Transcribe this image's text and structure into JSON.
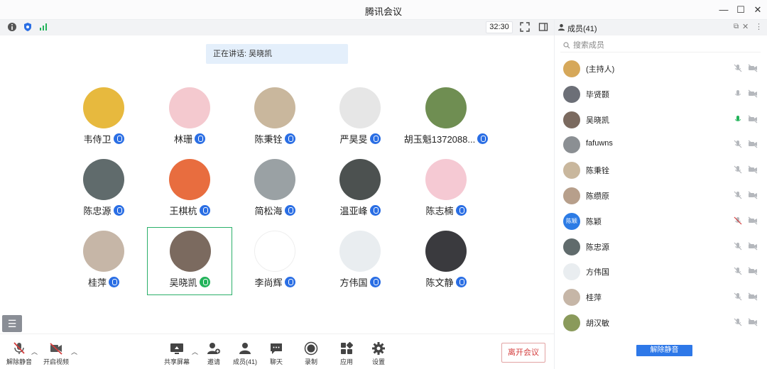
{
  "window": {
    "title": "腾讯会议"
  },
  "toolbar": {
    "timer": "32:30"
  },
  "speaking": {
    "label": "正在讲话: 吴晓凯"
  },
  "grid": [
    {
      "name": "韦侍卫",
      "mic": "on",
      "avatar": "#e7b93e"
    },
    {
      "name": "林珊",
      "mic": "on",
      "avatar": "#f4c9cf"
    },
    {
      "name": "陈秉铨",
      "mic": "on",
      "avatar": "#c9b79d"
    },
    {
      "name": "严昊旻",
      "mic": "on",
      "avatar": "#e6e6e6"
    },
    {
      "name": "胡玉魁1372088...",
      "mic": "on",
      "avatar": "#6f8e52"
    },
    {
      "name": "陈忠源",
      "mic": "on",
      "avatar": "#606b6c"
    },
    {
      "name": "王棋杭",
      "mic": "on",
      "avatar": "#e86d3f"
    },
    {
      "name": "简松海",
      "mic": "on",
      "avatar": "#9aa1a4"
    },
    {
      "name": "温亚峰",
      "mic": "on",
      "avatar": "#4c5150"
    },
    {
      "name": "陈志楠",
      "mic": "on",
      "avatar": "#f5c9d3"
    },
    {
      "name": "桂萍",
      "mic": "on",
      "avatar": "#c6b6a7"
    },
    {
      "name": "吴晓凯",
      "mic": "active",
      "avatar": "#7b6a5f"
    },
    {
      "name": "李尚辉",
      "mic": "on",
      "avatar": "#ffffff"
    },
    {
      "name": "方伟国",
      "mic": "on",
      "avatar": "#e9edf0"
    },
    {
      "name": "陈文静",
      "mic": "on",
      "avatar": "#3a3a3e"
    }
  ],
  "bottombar": {
    "unmute": "解除静音",
    "video": "开启视频",
    "share": "共享屏幕",
    "invite": "邀请",
    "members": "成员(41)",
    "chat": "聊天",
    "record": "录制",
    "apps": "应用",
    "settings": "设置",
    "leave": "离开会议"
  },
  "panel": {
    "title": "成员(41)",
    "search_placeholder": "搜索成员",
    "unmute_all": "解除静音",
    "members": [
      {
        "name": "(主持人)",
        "avatar": "#d6a85a",
        "mic": "muted"
      },
      {
        "name": "毕贤颢",
        "avatar": "#6c6f77",
        "mic": "off"
      },
      {
        "name": "吴晓凯",
        "avatar": "#7b6a5f",
        "mic": "active"
      },
      {
        "name": "fafuwns",
        "avatar": "#8b8f93",
        "mic": "muted"
      },
      {
        "name": "陈秉铨",
        "avatar": "#c9b79d",
        "mic": "muted"
      },
      {
        "name": "陈缵原",
        "avatar": "#b79f8b",
        "mic": "muted"
      },
      {
        "name": "陈颖",
        "avatar": "#2c7be5",
        "initials": "陈颖",
        "mic": "muted-red"
      },
      {
        "name": "陈忠源",
        "avatar": "#606b6c",
        "mic": "muted"
      },
      {
        "name": "方伟国",
        "avatar": "#e9edf0",
        "mic": "muted"
      },
      {
        "name": "桂萍",
        "avatar": "#c6b6a7",
        "mic": "muted"
      },
      {
        "name": "胡汉敏",
        "avatar": "#8a9a5b",
        "mic": "muted"
      }
    ]
  },
  "colors": {
    "accent": "#2a6ee4",
    "active": "#22b35a",
    "leave": "#d43d3d",
    "selected_border": "#2bb06a"
  }
}
